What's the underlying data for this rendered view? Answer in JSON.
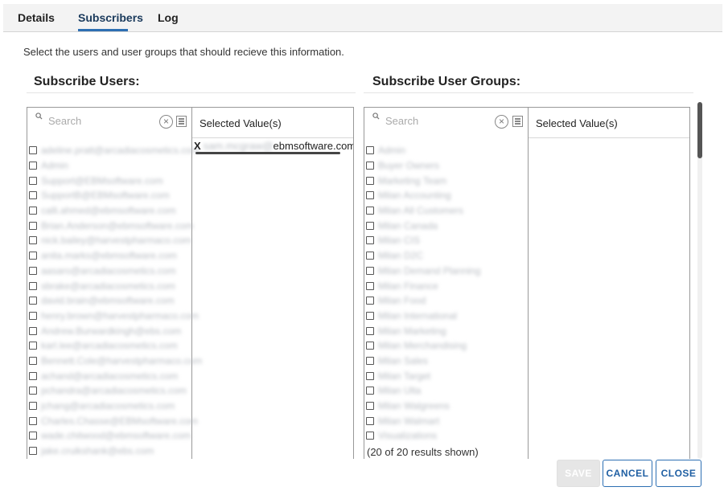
{
  "tabs": [
    {
      "label": "Details"
    },
    {
      "label": "Subscribers"
    },
    {
      "label": "Log"
    }
  ],
  "instructions": "Select the users and user groups that should recieve this information.",
  "users": {
    "title": "Subscribe Users:",
    "search_placeholder": "Search",
    "selected_header": "Selected Value(s)",
    "selected_values": [
      {
        "remove": "X",
        "text_visible": "ebmsoftware.com",
        "text_obscured": "sam.mcgraw@"
      }
    ],
    "items": [
      "adeline.pratt@arcadiacosmetics.com",
      "Admin",
      "Support@EBMsoftware.com",
      "SupportB@EBMsoftware.com",
      "calli.ahmed@ebmsoftware.com",
      "Brian.Anderson@ebmsoftware.com",
      "nick.bailey@harvestpharmaco.com",
      "anita.marks@ebmsoftware.com",
      "aasaro@arcadiacosmetics.com",
      "sbrake@arcadiacosmetics.com",
      "david.brain@ebmsoftware.com",
      "henry.brown@harvestpharmaco.com",
      "Andrew.Burwardkingh@ebs.com",
      "karl.lee@arcadiacosmetics.com",
      "Bennett.Cole@harvestpharmaco.com",
      "achand@arcadiacosmetics.com",
      "pchandra@arcadiacosmetics.com",
      "jchang@arcadiacosmetics.com",
      "Charles.Chasse@EBMsoftware.com",
      "wade.chitwood@ebmsoftware.com",
      "jake.cruikshank@ebs.com"
    ]
  },
  "groups": {
    "title": "Subscribe User Groups:",
    "search_placeholder": "Search",
    "selected_header": "Selected Value(s)",
    "items": [
      "Admin",
      "Buyer Owners",
      "Marketing Team",
      "Milan Accounting",
      "Milan All Customers",
      "Milan Canada",
      "Milan CIS",
      "Milan D2C",
      "Milan Demand Planning",
      "Milan Finance",
      "Milan Food",
      "Milan International",
      "Milan Marketing",
      "Milan Merchandising",
      "Milan Sales",
      "Milan Target",
      "Milan Ulta",
      "Milan Walgreens",
      "Milan Walmart",
      "Visualizations"
    ],
    "results_count": "(20 of 20 results shown)"
  },
  "buttons": {
    "save": "SAVE",
    "cancel": "CANCEL",
    "close": "CLOSE"
  },
  "icons": {
    "search": "magnifier",
    "clear": "circle-x",
    "select_all": "list-box"
  },
  "colors": {
    "accent": "#2d6fb3",
    "button_text": "#1f5fa3",
    "disabled": "#e6e6e6"
  }
}
